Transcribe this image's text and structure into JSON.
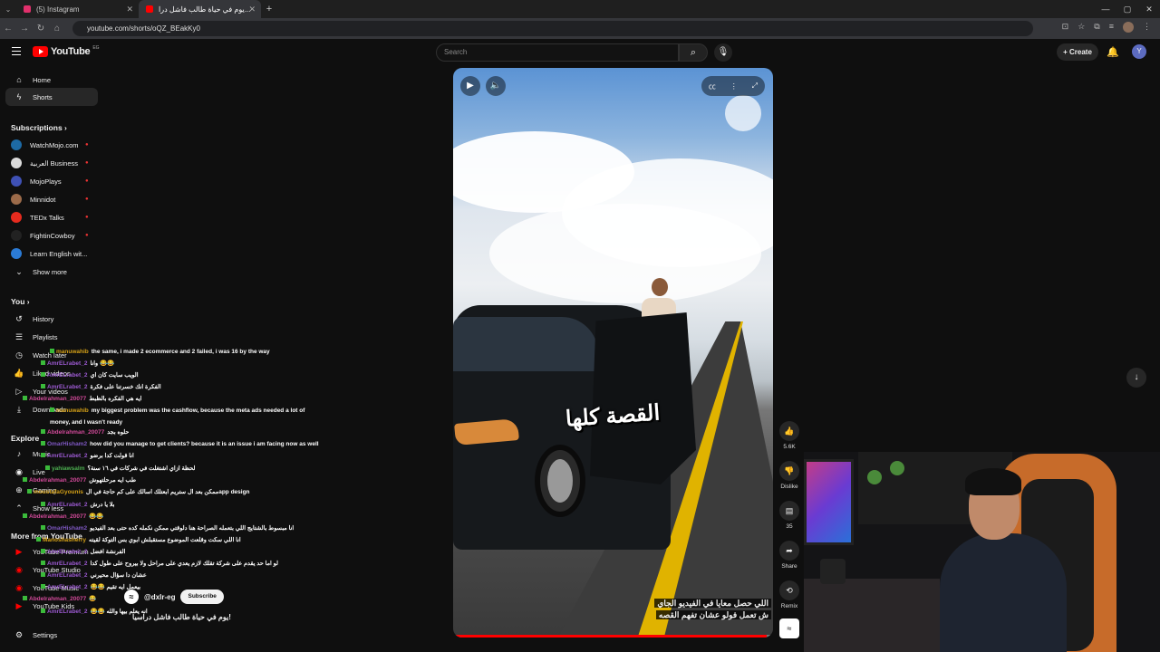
{
  "browser": {
    "tabs": [
      {
        "title": "(5) Instagram",
        "active": false,
        "color": "#e1306c"
      },
      {
        "title": "يوم في حياة طالب فاشل درا...",
        "active": true,
        "color": "#ff0000"
      }
    ],
    "url": "youtube.com/shorts/oQZ_BEakKy0"
  },
  "header": {
    "logo_text": "YouTube",
    "logo_country": "EG",
    "search_placeholder": "Search",
    "create_label": "Create",
    "avatar_letter": "Y"
  },
  "sidebar": {
    "main": [
      {
        "label": "Home",
        "icon": "home-icon"
      },
      {
        "label": "Shorts",
        "icon": "shorts-icon",
        "active": true
      }
    ],
    "subscriptions_title": "Subscriptions",
    "subscriptions": [
      {
        "label": "WatchMojo.com",
        "color": "#1d6aa5"
      },
      {
        "label": "العربية Business",
        "color": "#dcdcdc"
      },
      {
        "label": "MojoPlays",
        "color": "#3f51b5"
      },
      {
        "label": "Minnidot",
        "color": "#9c6b4a"
      },
      {
        "label": "TEDx Talks",
        "color": "#e62b1e"
      },
      {
        "label": "FightinCowboy",
        "color": "#222222"
      },
      {
        "label": "Learn English wit...",
        "color": "#2b7bd6"
      }
    ],
    "show_more": "Show more",
    "you_title": "You",
    "you_items": [
      {
        "label": "History",
        "icon": "history-icon"
      },
      {
        "label": "Playlists",
        "icon": "playlists-icon"
      },
      {
        "label": "Watch later",
        "icon": "clock-icon"
      },
      {
        "label": "Liked videos",
        "icon": "like-icon"
      },
      {
        "label": "Your videos",
        "icon": "your-videos-icon"
      },
      {
        "label": "Downloads",
        "icon": "download-icon"
      }
    ],
    "explore_title": "Explore",
    "explore_items": [
      {
        "label": "Music",
        "icon": "music-icon"
      },
      {
        "label": "Live",
        "icon": "live-icon"
      },
      {
        "label": "Gaming",
        "icon": "gaming-icon"
      },
      {
        "label": "Show less",
        "icon": "chevron-up-icon"
      }
    ],
    "more_title": "More from YouTube",
    "more_items": [
      {
        "label": "YouTube Premium"
      },
      {
        "label": "YouTube Studio"
      },
      {
        "label": "YouTube Music"
      },
      {
        "label": "YouTube Kids"
      }
    ],
    "settings": "Settings"
  },
  "chat": [
    {
      "user": "manuwahib",
      "msg": "the same, i made 2 ecommerce and 2 failed, i was 16 by the way",
      "color": "#d4a017"
    },
    {
      "user": "AmrELrabet_2",
      "msg": "وانا 😂😂",
      "color": "#9b59d0"
    },
    {
      "user": "AmrELrabet_2",
      "msg": "الويب سايت كان اي",
      "color": "#9b59d0"
    },
    {
      "user": "AmrELrabet_2",
      "msg": "الفكرة انك خسرتنا على فكرة",
      "color": "#9b59d0"
    },
    {
      "user": "Abdelrahman_20077",
      "msg": "ايه هي الفكره بالظبط",
      "color": "#d24a9a"
    },
    {
      "user": "manuwahib",
      "msg": "my biggest problem was the cashflow, because the meta ads needed a lot of money, and I wasn't ready",
      "color": "#d4a017"
    },
    {
      "user": "Abdelrahman_20077",
      "msg": "حلوه بجد",
      "color": "#d24a9a"
    },
    {
      "user": "OmarHisham2",
      "msg": "how did you manage to get clients? because it is an issue i am facing now as well",
      "color": "#7e57c2"
    },
    {
      "user": "AmrELrabet_2",
      "msg": "انا قولت كدا برضو",
      "color": "#9b59d0"
    },
    {
      "user": "yahiawsalm",
      "msg": "لحظة ازاي اشتغلت في شركات في ١٦ سنة؟",
      "color": "#4caf50"
    },
    {
      "user": "Abdelrahman_20077",
      "msg": "طب ايه مرحلتهوش",
      "color": "#d24a9a"
    },
    {
      "user": "moustafaGyounis",
      "msg": "ممكن بعد ال ستريم ابعتلك اسالك على كم حاجة في الapp design",
      "color": "#d4a017"
    },
    {
      "user": "AmrELrabet_2",
      "msg": "بلا يا درش",
      "color": "#9b59d0"
    },
    {
      "user": "Abdelrahman_20077",
      "msg": "😂😂",
      "color": "#d24a9a"
    },
    {
      "user": "OmarHisham2",
      "msg": "انا مبسوط بالشتايج اللي بتعمله الصراحة هنا دلوقتي ممكن نكمله كده حتى بعد الفيديو",
      "color": "#7e57c2"
    },
    {
      "user": "Manoshasherry",
      "msg": "انا اللي سكت وقلعت الموضوع مستقبلش ابوي بس التوكة لقيته",
      "color": "#d4a017"
    },
    {
      "user": "AmrELrabet_2",
      "msg": "الفرنشة افضل",
      "color": "#9b59d0"
    },
    {
      "user": "AmrELrabet_2",
      "msg": "لو اما حد يقدم على شركة تقلك لازم يعدي على مراحل ولا بيروح على طول كدا",
      "color": "#9b59d0"
    },
    {
      "user": "AmrELrabet_2",
      "msg": "عشان دا سؤال محيرني",
      "color": "#9b59d0"
    },
    {
      "user": "AmrELrabet_2",
      "msg": "😂😂 بيعمل ايه تقيم",
      "color": "#9b59d0"
    },
    {
      "user": "Abdelrahman_20077",
      "msg": "😂",
      "color": "#d24a9a"
    },
    {
      "user": "AmrELrabet_2",
      "msg": "😂😂 انه يعلم بيها والله",
      "color": "#9b59d0"
    }
  ],
  "video": {
    "sticker": "القصة كلها",
    "caption_line1": "اللي حصل معايا في الفيديو الجاي",
    "caption_line2": "ش تعمل فولو عشان تفهم القصه",
    "channel": "@dxlr-eg",
    "subscribe": "Subscribe",
    "title": "يوم في حياة طالب فاشل دراسيا!",
    "progress": 0.98
  },
  "actions": {
    "likes": "5.6K",
    "dislike": "Dislike",
    "comments": "35",
    "share": "Share",
    "remix": "Remix"
  }
}
